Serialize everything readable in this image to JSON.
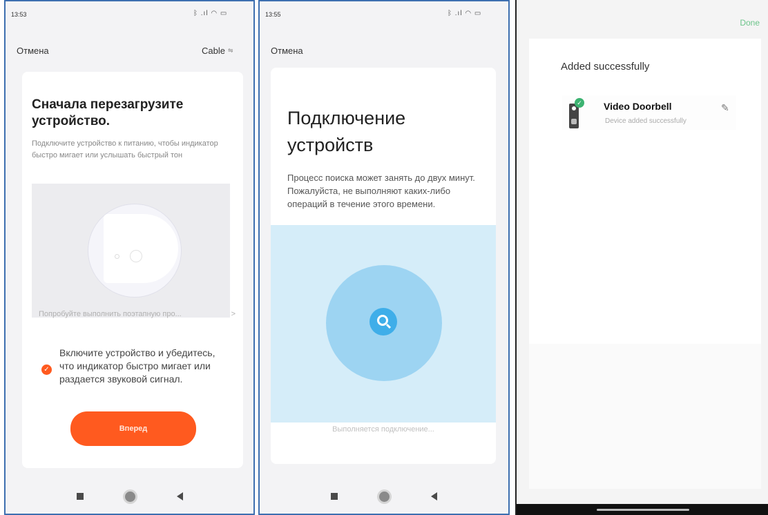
{
  "screen1": {
    "time": "13:53",
    "status_icons": "ᛒ .ıl ◠ ▭",
    "cancel_label": "Отмена",
    "top_right_label": "Cable",
    "top_right_icon": "switch-icon",
    "title": "Сначала перезагрузите устройство.",
    "description": "Подключите устройство к питанию, чтобы индикатор быстро мигает или услышать быстрый тон",
    "alt_link": "Попробуйте выполнить поэтапную про...",
    "alt_link_chevron": ">",
    "checkbox_text": "Включите устройство и убедитесь, что индикатор быстро мигает или раздается звуковой сигнал.",
    "checkbox_checked": true,
    "next_button": "Вперед"
  },
  "screen2": {
    "time": "13:55",
    "status_icons": "ᛒ .ıl ◠ ▭",
    "cancel_label": "Отмена",
    "title": "Подключение устройств",
    "description": "Процесс поиска может занять до двух минут. Пожалуйста, не выполняют каких-либо операций в течение этого времени.",
    "status_text": "Выполняется подключение...",
    "search_icon": "search-icon"
  },
  "screen3": {
    "done_label": "Done",
    "section_title": "Added successfully",
    "device_name": "Video Doorbell",
    "device_status": "Device added successfully",
    "edit_icon": "pencil-icon",
    "accent_color": "#3cb371"
  }
}
